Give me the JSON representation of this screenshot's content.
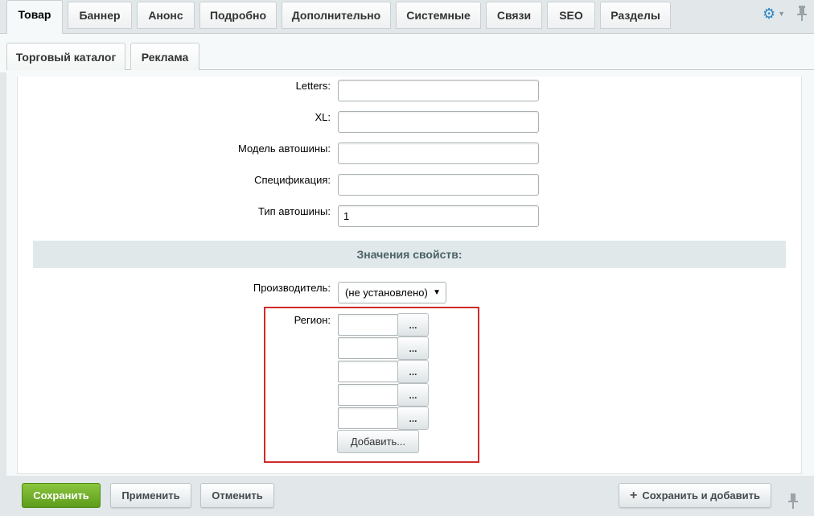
{
  "tabs": [
    {
      "label": "Товар",
      "active": true
    },
    {
      "label": "Баннер"
    },
    {
      "label": "Анонс"
    },
    {
      "label": "Подробно"
    },
    {
      "label": "Дополнительно"
    },
    {
      "label": "Системные"
    },
    {
      "label": "Связи"
    },
    {
      "label": "SEO"
    },
    {
      "label": "Разделы"
    }
  ],
  "subtabs": [
    {
      "label": "Торговый каталог"
    },
    {
      "label": "Реклама"
    }
  ],
  "icons": {
    "settings": "gear-icon",
    "pin": "pin-icon"
  },
  "fields": [
    {
      "label": "Letters:",
      "value": ""
    },
    {
      "label": "XL:",
      "value": ""
    },
    {
      "label": "Модель автошины:",
      "value": ""
    },
    {
      "label": "Спецификация:",
      "value": ""
    },
    {
      "label": "Тип автошины:",
      "value": "1"
    }
  ],
  "section_title": "Значения свойств:",
  "manufacturer": {
    "label": "Производитель:",
    "selected": "(не установлено)"
  },
  "region": {
    "label": "Регион:",
    "inputs": [
      "",
      "",
      "",
      "",
      ""
    ],
    "browse_label": "...",
    "add_label": "Добавить..."
  },
  "bottom": {
    "save": "Сохранить",
    "apply": "Применить",
    "cancel": "Отменить",
    "save_add": "Сохранить и добавить"
  },
  "colors": {
    "save_green": "#6aab23",
    "highlight_red": "#d12b2b",
    "gear_blue": "#2b86c7"
  }
}
